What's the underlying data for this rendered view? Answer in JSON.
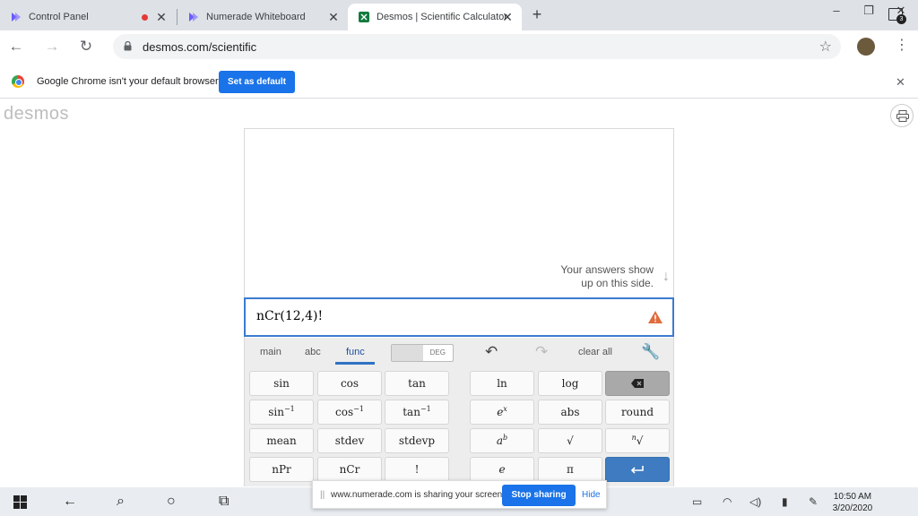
{
  "browser": {
    "tabs": [
      {
        "title": "Control Panel"
      },
      {
        "title": "Numerade Whiteboard"
      },
      {
        "title": "Desmos | Scientific Calculator"
      }
    ],
    "url": "desmos.com/scientific",
    "infobar": {
      "message": "Google Chrome isn't your default browser",
      "button": "Set as default"
    }
  },
  "desmos": {
    "logo": "desmos",
    "hint_line1": "Your answers show",
    "hint_line2": "up on this side.",
    "expression": "nCr(12,4)!",
    "keyboard": {
      "tabs": [
        "main",
        "abc",
        "func"
      ],
      "active_tab": "func",
      "angle_mode": "DEG",
      "clear_all": "clear all",
      "keys": {
        "sin": "sin",
        "cos": "cos",
        "tan": "tan",
        "ln": "ln",
        "log": "log",
        "asin": "sin",
        "acos": "cos",
        "atan": "tan",
        "inverse_exp": "−1",
        "exp_base": "e",
        "exp_sup": "x",
        "abs": "abs",
        "round": "round",
        "mean": "mean",
        "stdev": "stdev",
        "stdevp": "stdevp",
        "pow_base": "a",
        "pow_sup": "b",
        "sqrt": "√",
        "nthroot_index": "n",
        "nthroot": "√",
        "nPr": "nPr",
        "nCr": "nCr",
        "factorial": "!",
        "e": "e",
        "pi": "π"
      }
    }
  },
  "share_banner": {
    "message": "www.numerade.com is sharing your screen.",
    "stop": "Stop sharing",
    "hide": "Hide"
  },
  "taskbar": {
    "time": "10:50 AM",
    "date": "3/20/2020",
    "notifications": "3"
  },
  "colors": {
    "accent": "#1a73e8",
    "desmos_blue": "#3e7bc0",
    "warning": "#e06b3c"
  }
}
